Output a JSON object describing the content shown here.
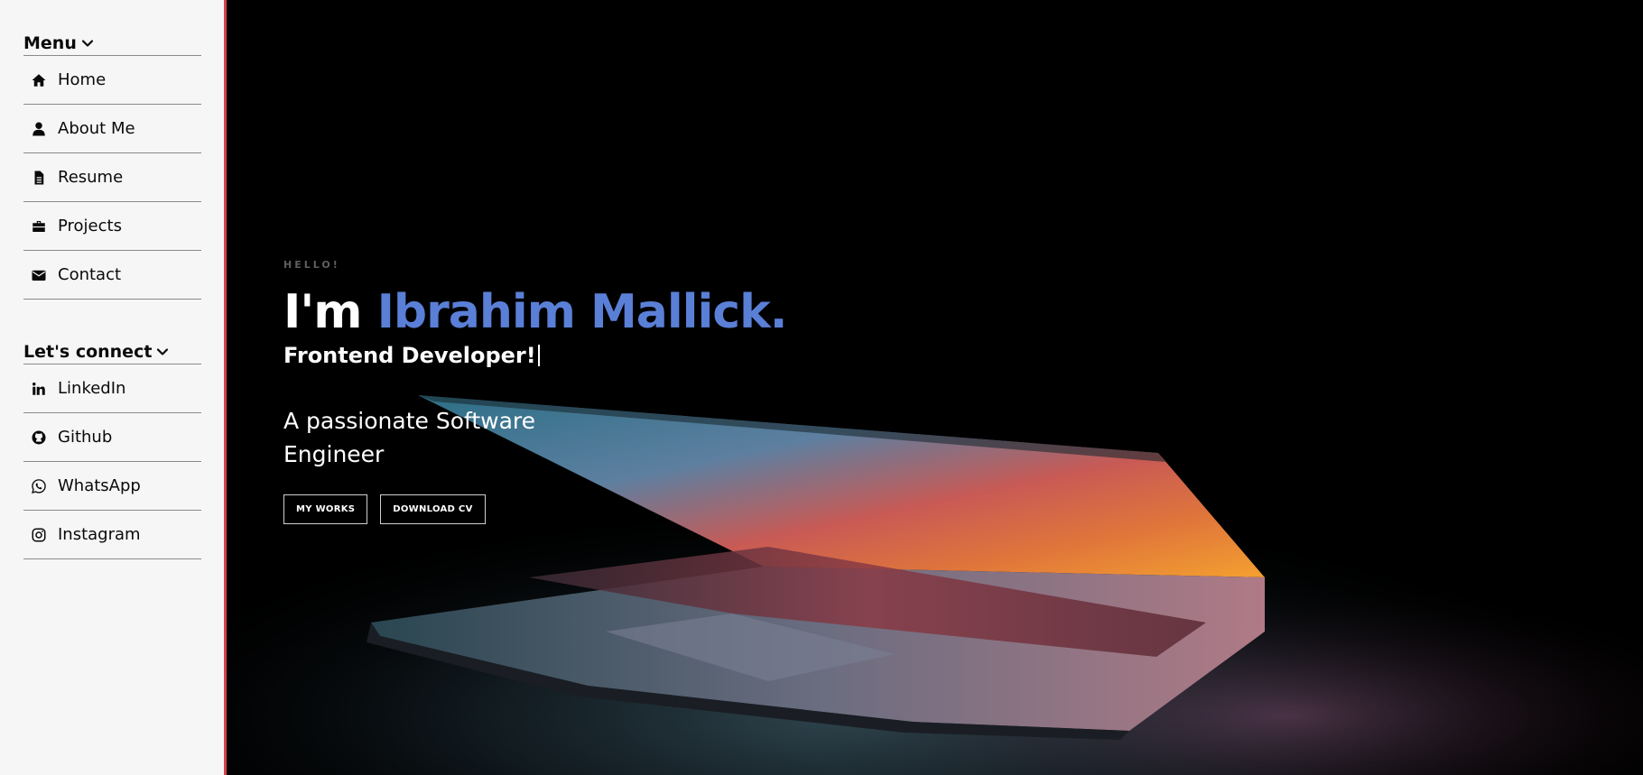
{
  "sidebar": {
    "menu_title": "Menu",
    "menu_items": [
      {
        "label": "Home",
        "icon": "home-icon"
      },
      {
        "label": "About Me",
        "icon": "user-icon"
      },
      {
        "label": "Resume",
        "icon": "file-icon"
      },
      {
        "label": "Projects",
        "icon": "briefcase-icon"
      },
      {
        "label": "Contact",
        "icon": "envelope-icon"
      }
    ],
    "connect_title": "Let's connect",
    "connect_items": [
      {
        "label": "LinkedIn",
        "icon": "linkedin-icon"
      },
      {
        "label": "Github",
        "icon": "github-icon"
      },
      {
        "label": "WhatsApp",
        "icon": "whatsapp-icon"
      },
      {
        "label": "Instagram",
        "icon": "instagram-icon"
      }
    ],
    "accent_border_color": "#d9434b"
  },
  "hero": {
    "greeting": "HELLO!",
    "headline_prefix": "I'm ",
    "headline_name": "Ibrahim Mallick.",
    "role": "Frontend Developer!",
    "tagline": "A passionate Software Engineer",
    "buttons": {
      "works": "MY WORKS",
      "cv": "DOWNLOAD CV"
    },
    "name_color": "#5a7fd6",
    "background": "laptop-dark-photo"
  }
}
